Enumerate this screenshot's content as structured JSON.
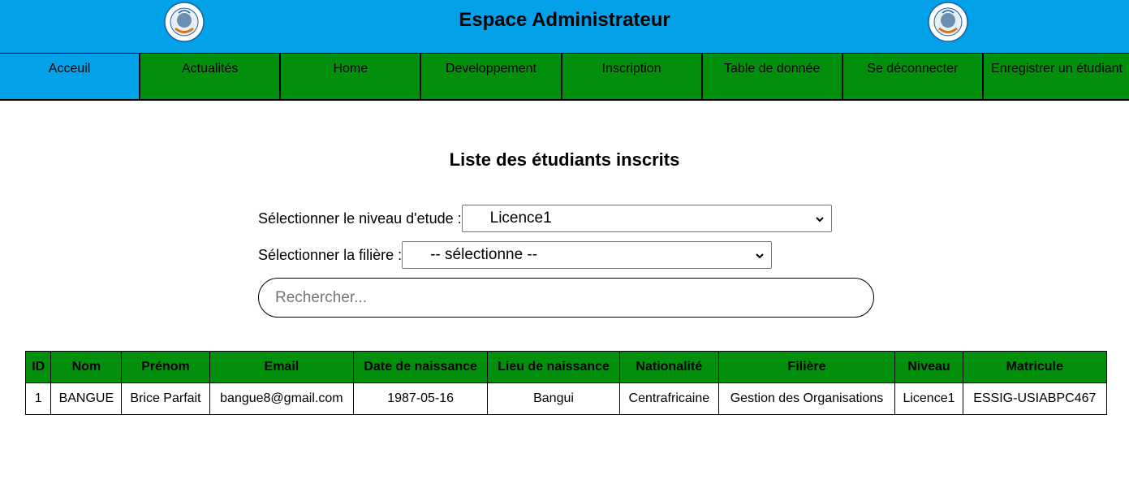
{
  "header": {
    "title": "Espace Administrateur",
    "logo_icon": "school-seal-logo",
    "colors": {
      "bar": "#03a1e8",
      "nav": "#028f0c"
    }
  },
  "nav": {
    "items": [
      {
        "label": "Acceuil",
        "active": true
      },
      {
        "label": "Actualités"
      },
      {
        "label": "Home"
      },
      {
        "label": "Developpement"
      },
      {
        "label": "Inscription"
      },
      {
        "label": "Table de donnée"
      },
      {
        "label": "Se déconnecter"
      },
      {
        "label": "Enregistrer un étudiant"
      }
    ]
  },
  "main": {
    "title": "Liste des étudiants inscrits",
    "level_label": "Sélectionner le niveau d'etude :",
    "level_value": "Licence1",
    "filiere_label": "Sélectionner la filière :",
    "filiere_value": "-- sélectionne --",
    "search_placeholder": "Rechercher..."
  },
  "table": {
    "headers": [
      "ID",
      "Nom",
      "Prénom",
      "Email",
      "Date de naissance",
      "Lieu de naissance",
      "Nationalité",
      "Filière",
      "Niveau",
      "Matricule"
    ],
    "rows": [
      [
        "1",
        "BANGUE",
        "Brice Parfait",
        "bangue8@gmail.com",
        "1987-05-16",
        "Bangui",
        "Centrafricaine",
        "Gestion des Organisations",
        "Licence1",
        "ESSIG-USIABPC467"
      ]
    ]
  }
}
